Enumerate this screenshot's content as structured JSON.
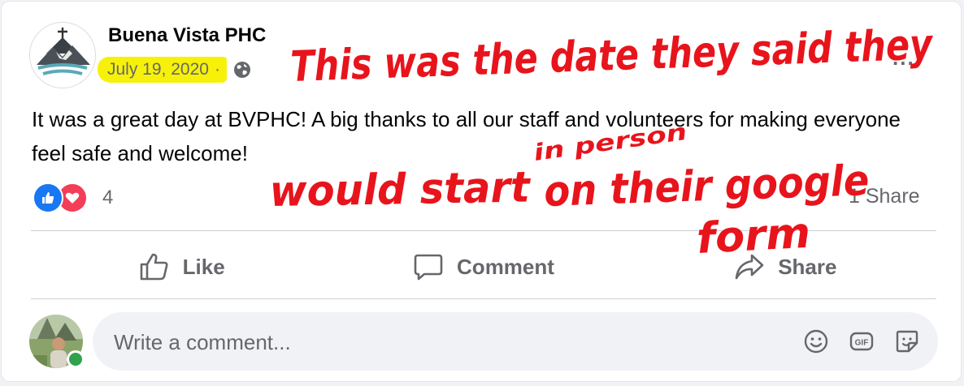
{
  "post": {
    "author": "Buena Vista PHC",
    "date": "July 19, 2020",
    "date_separator": "·",
    "privacy_icon": "globe-icon",
    "more_options": "...",
    "text": "It was a great day at BVPHC! A big thanks to all our staff and volunteers for making everyone feel safe and welcome!"
  },
  "stats": {
    "reaction_icons": [
      "like-icon",
      "love-icon"
    ],
    "reaction_count": "4",
    "share_count": "1 Share"
  },
  "actions": {
    "like": "Like",
    "comment": "Comment",
    "share": "Share"
  },
  "comment": {
    "placeholder": "Write a comment...",
    "icons": [
      "emoji-icon",
      "gif-icon",
      "sticker-icon"
    ]
  },
  "annotation": {
    "lines": [
      "This was the date they said they",
      "in person",
      "would start",
      "on their google",
      "form"
    ],
    "color": "#e8141c",
    "highlight_color": "#f7f10a"
  },
  "colors": {
    "like_blue": "#1877f2",
    "love_red": "#f33e58",
    "online_green": "#31a24c",
    "secondary_text": "#65676b"
  }
}
